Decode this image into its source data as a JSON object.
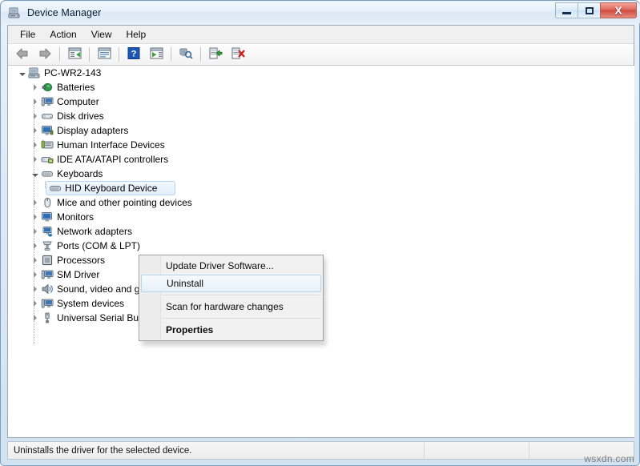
{
  "window": {
    "title": "Device Manager",
    "icon": "device-manager-icon",
    "controls": {
      "minimize": "–",
      "maximize": "□",
      "close": "X"
    }
  },
  "menubar": {
    "items": [
      {
        "label": "File",
        "name": "menu-file"
      },
      {
        "label": "Action",
        "name": "menu-action"
      },
      {
        "label": "View",
        "name": "menu-view"
      },
      {
        "label": "Help",
        "name": "menu-help"
      }
    ]
  },
  "toolbar": {
    "buttons": [
      {
        "name": "back-icon",
        "icon": "arrow-left"
      },
      {
        "name": "forward-icon",
        "icon": "arrow-right"
      },
      {
        "name": "show-hide-console-tree-icon",
        "icon": "window-pane"
      },
      {
        "name": "properties-icon",
        "icon": "window-properties"
      },
      {
        "name": "help-icon",
        "icon": "question-mark"
      },
      {
        "name": "show-hide-action-pane-icon",
        "icon": "window-play"
      },
      {
        "name": "scan-for-hardware-changes-icon",
        "icon": "monitor-magnifier"
      },
      {
        "name": "update-driver-software-icon",
        "icon": "driver-update"
      },
      {
        "name": "uninstall-icon",
        "icon": "driver-uninstall"
      }
    ]
  },
  "tree": {
    "root": {
      "label": "PC-WR2-143",
      "icon": "computer-icon",
      "expanded": true
    },
    "items": [
      {
        "label": "Batteries",
        "icon": "battery-icon",
        "indent": 1,
        "expanded": false
      },
      {
        "label": "Computer",
        "icon": "computer-device-icon",
        "indent": 1,
        "expanded": false
      },
      {
        "label": "Disk drives",
        "icon": "disk-drive-icon",
        "indent": 1,
        "expanded": false
      },
      {
        "label": "Display adapters",
        "icon": "display-adapter-icon",
        "indent": 1,
        "expanded": false
      },
      {
        "label": "Human Interface Devices",
        "icon": "hid-icon",
        "indent": 1,
        "expanded": false
      },
      {
        "label": "IDE ATA/ATAPI controllers",
        "icon": "ide-controller-icon",
        "indent": 1,
        "expanded": false
      },
      {
        "label": "Keyboards",
        "icon": "keyboard-icon",
        "indent": 1,
        "expanded": true
      },
      {
        "label": "HID Keyboard Device",
        "icon": "keyboard-icon",
        "indent": 2,
        "selected": true
      },
      {
        "label": "Mice and other pointing devices",
        "icon": "mouse-icon",
        "indent": 1,
        "expanded": false
      },
      {
        "label": "Monitors",
        "icon": "monitor-icon",
        "indent": 1,
        "expanded": false
      },
      {
        "label": "Network adapters",
        "icon": "network-adapter-icon",
        "indent": 1,
        "expanded": false
      },
      {
        "label": "Ports (COM & LPT)",
        "icon": "port-icon",
        "indent": 1,
        "expanded": false
      },
      {
        "label": "Processors",
        "icon": "processor-icon",
        "indent": 1,
        "expanded": false
      },
      {
        "label": "SM Driver",
        "icon": "sm-driver-icon",
        "indent": 1,
        "expanded": false
      },
      {
        "label": "Sound, video and game controllers",
        "icon": "sound-icon",
        "indent": 1,
        "expanded": false
      },
      {
        "label": "System devices",
        "icon": "system-device-icon",
        "indent": 1,
        "expanded": false
      },
      {
        "label": "Universal Serial Bus controllers",
        "icon": "usb-icon",
        "indent": 1,
        "expanded": false
      }
    ]
  },
  "context_menu": {
    "items": [
      {
        "label": "Update Driver Software...",
        "name": "ctx-update-driver-software",
        "type": "item"
      },
      {
        "label": "Uninstall",
        "name": "ctx-uninstall",
        "type": "item",
        "selected": true
      },
      {
        "type": "separator"
      },
      {
        "label": "Scan for hardware changes",
        "name": "ctx-scan-for-hardware-changes",
        "type": "item"
      },
      {
        "type": "separator"
      },
      {
        "label": "Properties",
        "name": "ctx-properties",
        "type": "item",
        "bold": true
      }
    ]
  },
  "statusbar": {
    "text": "Uninstalls the driver for the selected device."
  },
  "watermark": {
    "text": "wsxdn.com"
  },
  "colors": {
    "selection_border": "#b5d4ef",
    "selection_fill": "#e2eefa",
    "close_button": "#cf4a3e",
    "window_frame": "#7a9dc0"
  }
}
